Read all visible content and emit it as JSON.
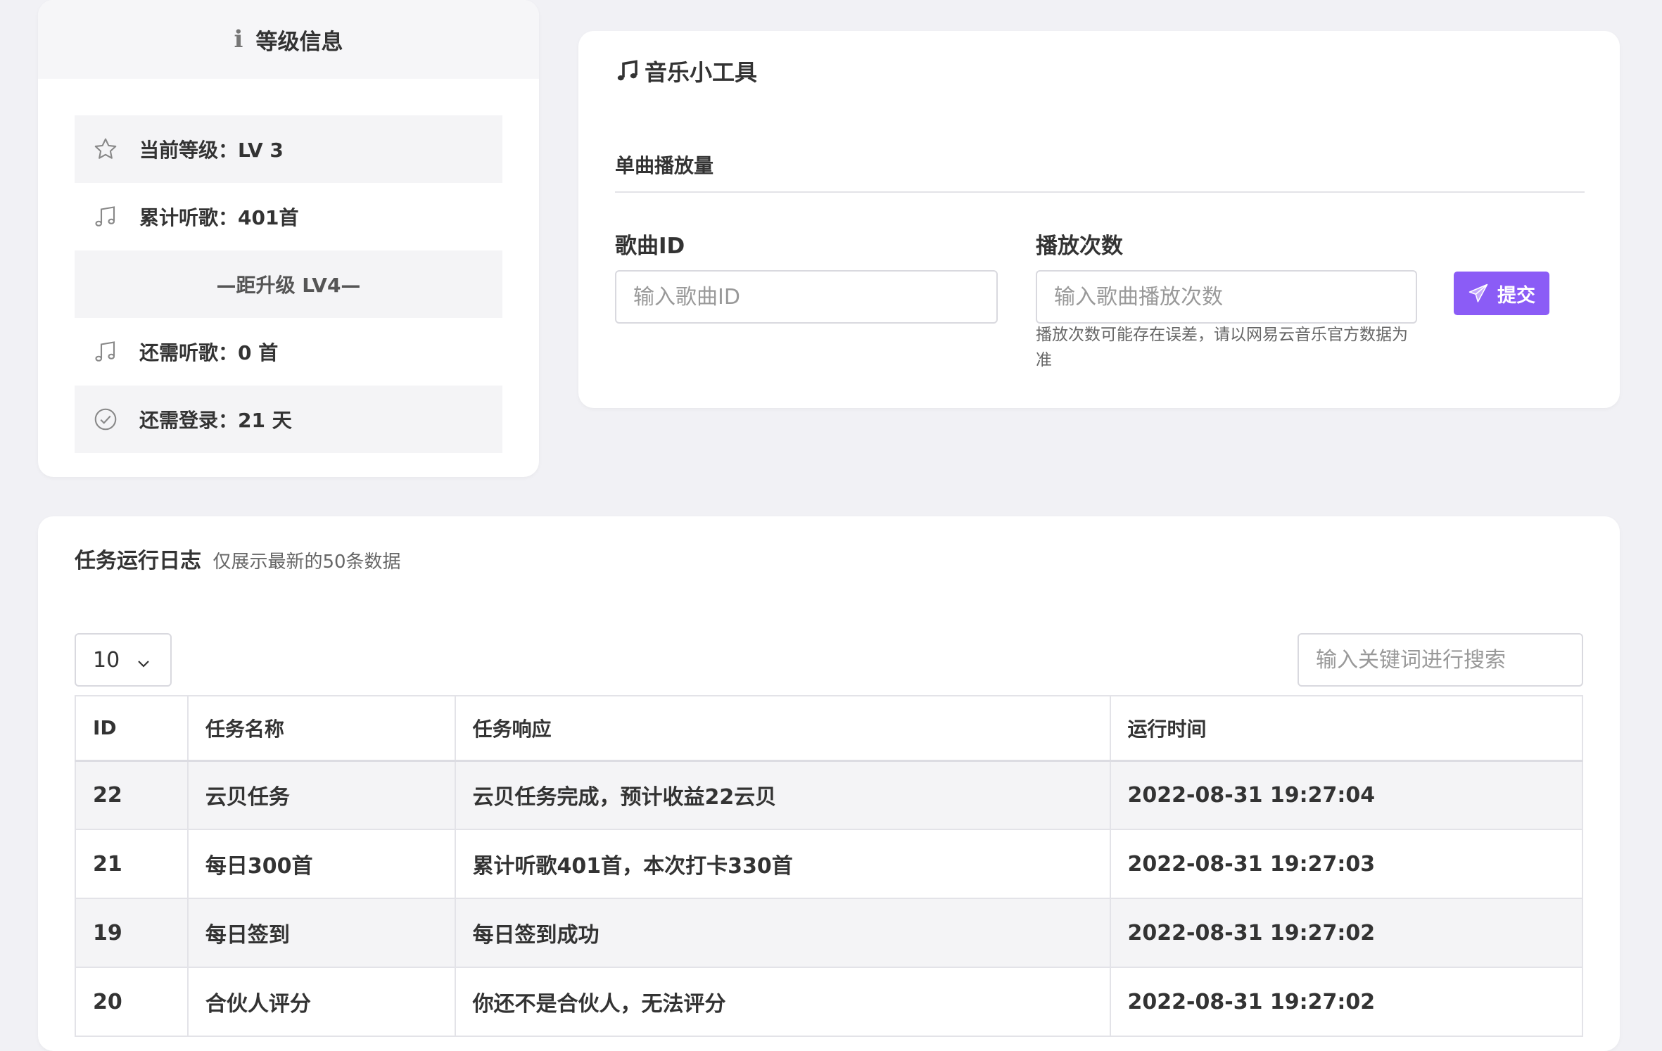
{
  "level_card": {
    "title": "等级信息",
    "icon": "info-icon",
    "rows": [
      {
        "icon": "star-icon",
        "label": "当前等级：LV 3"
      },
      {
        "icon": "music-note-icon",
        "label": "累计听歌：401首"
      },
      {
        "label": "—距升级 LV4—"
      },
      {
        "icon": "music-note-icon",
        "label": "还需听歌：0 首"
      },
      {
        "icon": "check-circle-icon",
        "label": "还需登录：21 天"
      }
    ]
  },
  "music_tools": {
    "title": "音乐小工具",
    "icon": "music-note-icon",
    "section_label": "单曲播放量",
    "song_id": {
      "label": "歌曲ID",
      "placeholder": "输入歌曲ID",
      "value": ""
    },
    "play_count": {
      "label": "播放次数",
      "placeholder": "输入歌曲播放次数",
      "value": ""
    },
    "hint": "播放次数可能存在误差，请以网易云音乐官方数据为准",
    "submit_label": "提交",
    "accent": "#8b5cf6"
  },
  "task_log": {
    "title": "任务运行日志",
    "subtitle": "仅展示最新的50条数据",
    "page_size": "10",
    "search_placeholder": "输入关键词进行搜索",
    "columns": [
      "ID",
      "任务名称",
      "任务响应",
      "运行时间"
    ],
    "rows": [
      {
        "id": "22",
        "name": "云贝任务",
        "response": "云贝任务完成，预计收益22云贝",
        "time": "2022-08-31 19:27:04"
      },
      {
        "id": "21",
        "name": "每日300首",
        "response": "累计听歌401首，本次打卡330首",
        "time": "2022-08-31 19:27:03"
      },
      {
        "id": "19",
        "name": "每日签到",
        "response": "每日签到成功",
        "time": "2022-08-31 19:27:02"
      },
      {
        "id": "20",
        "name": "合伙人评分",
        "response": "你还不是合伙人，无法评分",
        "time": "2022-08-31 19:27:02"
      }
    ]
  }
}
